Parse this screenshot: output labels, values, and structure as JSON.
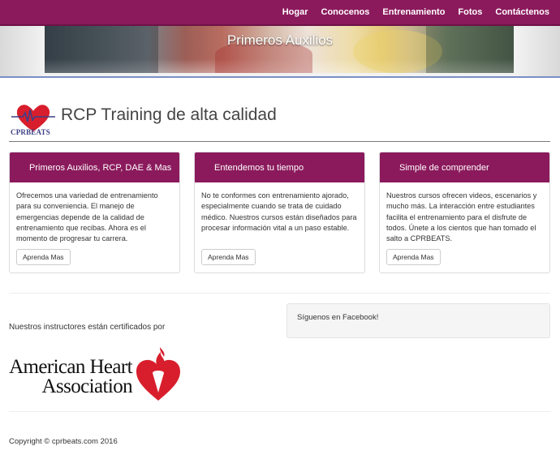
{
  "nav": {
    "items": [
      {
        "label": "Hogar"
      },
      {
        "label": "Conocenos"
      },
      {
        "label": "Entrenamiento"
      },
      {
        "label": "Fotos"
      },
      {
        "label": "Contáctenos"
      }
    ]
  },
  "carousel": {
    "caption": "Primeros Auxilios",
    "slide_count": 3,
    "active_slide": 3
  },
  "header": {
    "logo_text": "CPRBEATS",
    "title": "RCP Training de alta calidad"
  },
  "cards": [
    {
      "title": "Primeros Auxilios, RCP, DAE & Mas",
      "body": "Ofrecemos una variedad de entrenamiento para su conveniencia. El manejo de emergencias depende de la calidad de entrenamiento que recibas. Ahora es el momento de progresar tu carrera.",
      "button": "Aprenda Mas"
    },
    {
      "title": "Entendemos tu tiempo",
      "body": "No te conformes con entrenamiento ajorado, especialmente cuando se trata de cuidado médico. Nuestros cursos están diseñados para procesar información vital a un paso estable.",
      "button": "Aprenda Mas"
    },
    {
      "title": "Simple de comprender",
      "body": "Nuestros cursos ofrecen videos, escenarios y mucho más. La interacción entre estudiantes facilita el entrenamiento para el disfrute de todos. Únete a los cientos que han tomado el salto a CPRBEATS.",
      "button": "Aprenda Mas"
    }
  ],
  "certification": {
    "text": "Nuestros instructores están certificados por",
    "org_line1": "American Heart",
    "org_line2": "Association"
  },
  "facebook": {
    "label": "Síguenos en Facebook!"
  },
  "footer": {
    "copyright": "Copyright © cprbeats.com 2016"
  },
  "colors": {
    "brand": "#8b1a5c",
    "heart_red": "#d81e2c"
  }
}
